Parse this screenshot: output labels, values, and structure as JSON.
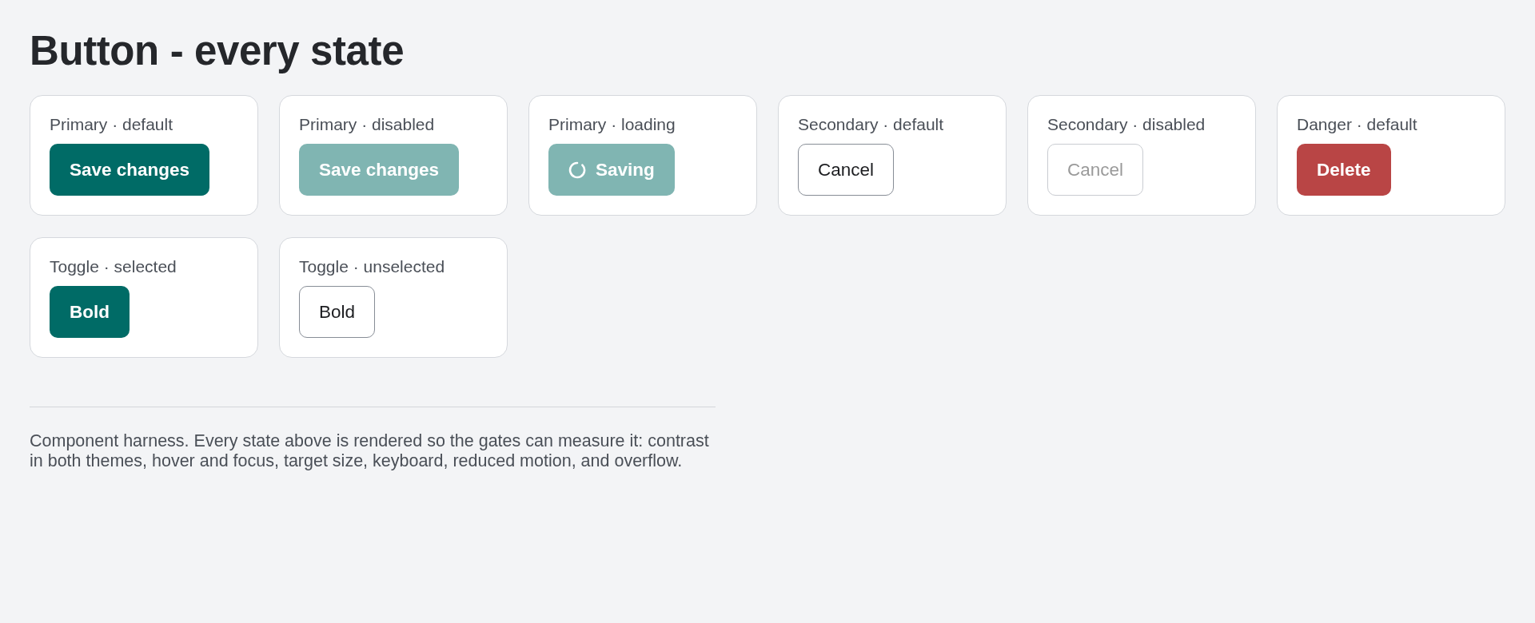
{
  "title": "Button - every state",
  "cards": [
    {
      "label": "Primary · default",
      "button": {
        "kind": "primary",
        "text": "Save changes",
        "disabled": false,
        "loading": false
      }
    },
    {
      "label": "Primary · disabled",
      "button": {
        "kind": "primary",
        "text": "Save changes",
        "disabled": true,
        "loading": false
      }
    },
    {
      "label": "Primary · loading",
      "button": {
        "kind": "primary",
        "text": "Saving",
        "disabled": false,
        "loading": true
      }
    },
    {
      "label": "Secondary · default",
      "button": {
        "kind": "secondary",
        "text": "Cancel",
        "disabled": false
      }
    },
    {
      "label": "Secondary · disabled",
      "button": {
        "kind": "secondary",
        "text": "Cancel",
        "disabled": true
      }
    },
    {
      "label": "Danger · default",
      "button": {
        "kind": "danger",
        "text": "Delete",
        "disabled": false
      }
    },
    {
      "label": "Toggle · selected",
      "button": {
        "kind": "toggle",
        "text": "Bold",
        "selected": true
      }
    },
    {
      "label": "Toggle · unselected",
      "button": {
        "kind": "toggle",
        "text": "Bold",
        "selected": false
      }
    }
  ],
  "note": "Component harness. Every state above is rendered so the gates can measure it: contrast in both themes, hover and focus, target size, keyboard, reduced motion, and overflow."
}
